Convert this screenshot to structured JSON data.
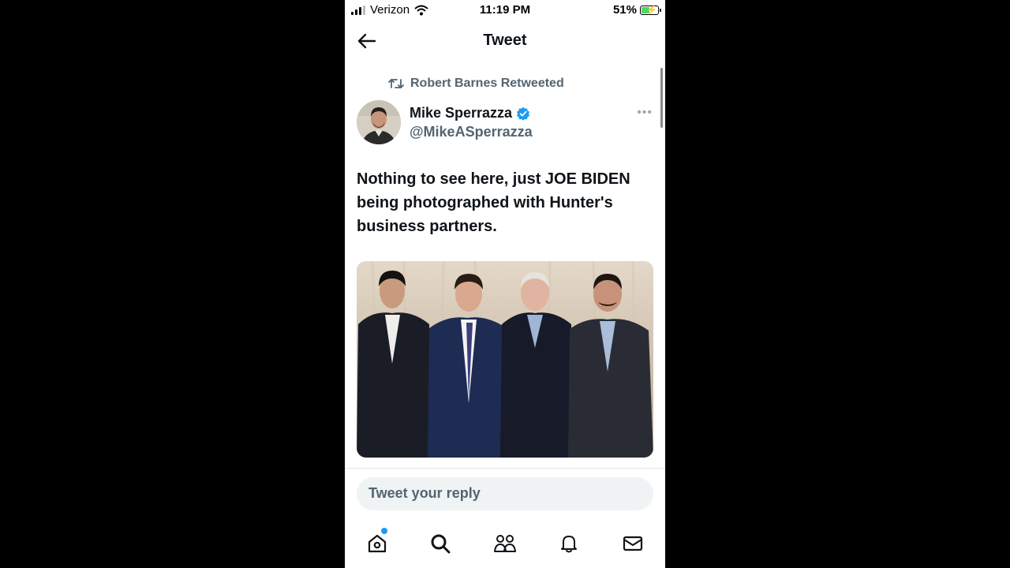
{
  "status_bar": {
    "carrier": "Verizon",
    "time": "11:19 PM",
    "battery_percent": "51%",
    "battery_level": 0.51,
    "icons": [
      "signal-icon",
      "wifi-icon",
      "battery-charging-icon"
    ]
  },
  "nav": {
    "title": "Tweet",
    "back_icon": "back-arrow-icon"
  },
  "tweet": {
    "retweeted_by": "Robert Barnes Retweeted",
    "author_name": "Mike Sperrazza",
    "verified": true,
    "author_handle": "@MikeASperrazza",
    "text": "Nothing to see here, just JOE BIDEN being photographed with Hunter's business partners.",
    "more_icon": "more-options-icon",
    "media": "photo"
  },
  "reply": {
    "placeholder": "Tweet your reply"
  },
  "tab_bar": {
    "tabs": [
      "home",
      "search",
      "communities",
      "notifications",
      "messages"
    ],
    "home_has_notification": true
  },
  "colors": {
    "text_primary": "#0f1419",
    "text_secondary": "#536471",
    "accent": "#1d9bf0",
    "reply_bg": "#eff3f4"
  }
}
